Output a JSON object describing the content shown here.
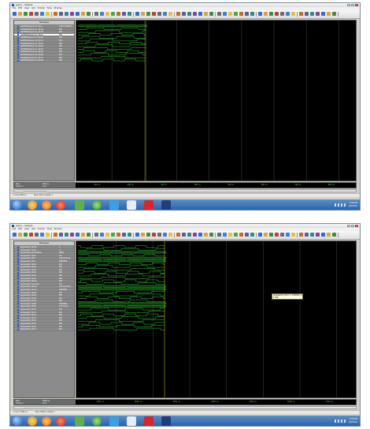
{
  "window": {
    "title": "wave - default"
  },
  "menu": [
    "File",
    "Edit",
    "View",
    "Add",
    "Format",
    "Tools",
    "Window"
  ],
  "pane_header": "Messages",
  "shot1": {
    "signals": [
      {
        "name": "/selfTestSequencer_tb/d",
        "value": "1010 1010011"
      },
      {
        "name": "/selfTestSequencer_tb/clk",
        "value": "St0"
      },
      {
        "name": "/selfTestSequencer_tb/rst",
        "value": "St0"
      },
      {
        "name": "/selfTestSequencer_tb/en",
        "value": "St0"
      },
      {
        "name": "/selfTestSequencer_tb/q0",
        "value": "St0"
      },
      {
        "name": "/selfTestSequencer_tb/q1",
        "value": "St0"
      },
      {
        "name": "/selfTestSequencer_tb/q2",
        "value": "St0"
      },
      {
        "name": "/selfTestSequencer_tb/q3",
        "value": "St0"
      },
      {
        "name": "/selfTestSequencer_tb/q4",
        "value": "St0"
      },
      {
        "name": "/selfTestSequencer_tb/q5",
        "value": "St0"
      },
      {
        "name": "/selfTestSequencer_tb/q6",
        "value": "St0"
      },
      {
        "name": "/selfTestSequencer_tb/q7",
        "value": "St0"
      },
      {
        "name": "/selfTestSequencer_tb/q8",
        "value": "St0"
      }
    ],
    "now_label": "Now",
    "now_value": "500 ns",
    "cursor_label": "Cursor 1",
    "cursor_value": "0 ns",
    "ticks": [
      "100 ns",
      "200 ns",
      "300 ns",
      "400 ns",
      "500 ns",
      "600 ns",
      "700 ns",
      "800 ns"
    ],
    "status": [
      "0 ns to 869 ns",
      "Now: 500 ns  Delta: 1"
    ]
  },
  "shot2": {
    "signals": [
      {
        "name": "/bypassCtrl_tb/clk",
        "value": "1"
      },
      {
        "name": "/bypassCtrl_tb/rst",
        "value": "0"
      },
      {
        "name": "/bypassCtrl_tb/addrBus",
        "value": "0000"
      },
      {
        "name": "/bypassCtrl_tb/en",
        "value": "St1"
      },
      {
        "name": "/bypassCtrl_tb/d",
        "value": "1111111111"
      },
      {
        "name": "/bypassCtrl_tb/q",
        "value": "0000000"
      },
      {
        "name": "/bypassCtrl_tb/s0",
        "value": "St0"
      },
      {
        "name": "/bypassCtrl_tb/s1",
        "value": "St0"
      },
      {
        "name": "/bypassCtrl_tb/s2",
        "value": "St0"
      },
      {
        "name": "/bypassCtrl_tb/s3",
        "value": "St0"
      },
      {
        "name": "/bypassCtrl_tb/s4",
        "value": "St0"
      },
      {
        "name": "/bypassCtrl_tb/s5",
        "value": "St0"
      },
      {
        "name": "/bypassCtrl_tb/sel",
        "value": "St0"
      },
      {
        "name": "/bypassCtrl_tb/mode",
        "value": "St1"
      },
      {
        "name": "/bypassCtrl_tb/out",
        "value": "1111111111"
      },
      {
        "name": "/bypassCtrl_tb/cnt",
        "value": "0000000"
      },
      {
        "name": "/bypassCtrl_tb/a0",
        "value": "St0"
      },
      {
        "name": "/bypassCtrl_tb/a1",
        "value": "St0"
      },
      {
        "name": "/bypassCtrl_tb/a2",
        "value": "St0"
      },
      {
        "name": "/bypassCtrl_tb/a3",
        "value": "St0"
      },
      {
        "name": "/bypassCtrl_tb/b0",
        "value": "0000000"
      },
      {
        "name": "/bypassCtrl_tb/b1",
        "value": "11111111"
      },
      {
        "name": "/bypassCtrl_tb/c0",
        "value": "St0"
      },
      {
        "name": "/bypassCtrl_tb/c1",
        "value": "St0"
      },
      {
        "name": "/bypassCtrl_tb/c2",
        "value": "St0"
      },
      {
        "name": "/bypassCtrl_tb/c3",
        "value": "St0"
      },
      {
        "name": "/bypassCtrl_tb/c4",
        "value": "St0"
      },
      {
        "name": "/bypassCtrl_tb/c5",
        "value": "St0"
      },
      {
        "name": "/bypassCtrl_tb/c6",
        "value": "St0"
      },
      {
        "name": "/bypassCtrl_tb/c7",
        "value": "St0"
      }
    ],
    "now_label": "Now",
    "now_value": "5000 ns",
    "cursor_label": "Cursor 1",
    "cursor_value": "0 ns",
    "ticks": [
      "1000 ns",
      "2000 ns",
      "3000 ns",
      "4000 ns",
      "5000 ns",
      "6000 ns",
      "7000 ns"
    ],
    "status": [
      "0 ns to 7290 ns",
      "Now: 5000 ns  Delta: 1"
    ],
    "tooltip": [
      "/bypassCtrl_tb/c1 1 100000 ns",
      "1 St0"
    ]
  },
  "taskbar": {
    "time": "4:06 PM",
    "date": "3/8/2016"
  },
  "colors": {
    "wave": "#33e033",
    "bus_fill": "#0b3a0b",
    "background": "#000000",
    "grid": "#1e1e1e"
  }
}
